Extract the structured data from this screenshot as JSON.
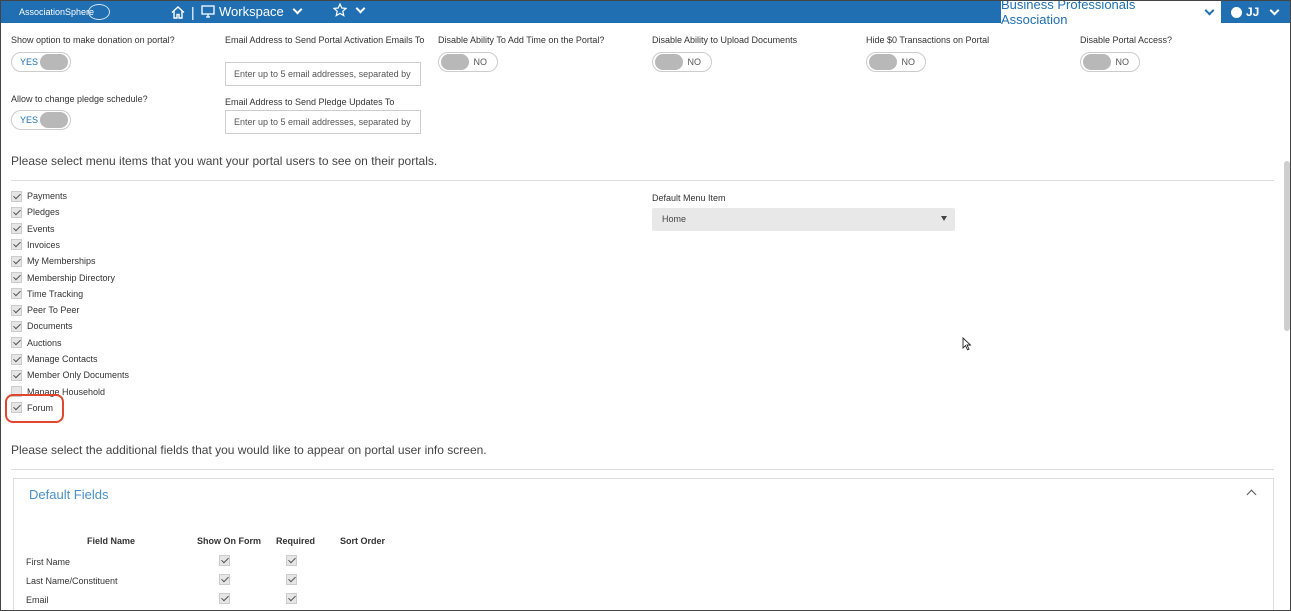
{
  "topbar": {
    "logo_text": "AssociationSphere",
    "workspace_label": "Workspace",
    "org_name": "Business Professionals Association",
    "user_initials": "JJ",
    "separator": "|"
  },
  "settings": {
    "donation": {
      "label": "Show option to make donation on portal?",
      "value": "YES"
    },
    "activation_email": {
      "label": "Email Address to Send Portal Activation Emails To",
      "placeholder": "Enter up to 5 email addresses, separated by"
    },
    "disable_add_time": {
      "label": "Disable Ability To Add Time on the Portal?",
      "value": "NO"
    },
    "disable_upload": {
      "label": "Disable Ability to Upload Documents",
      "value": "NO"
    },
    "hide_zero": {
      "label": "Hide $0 Transactions on Portal",
      "value": "NO"
    },
    "disable_portal": {
      "label": "Disable Portal Access?",
      "value": "NO"
    },
    "pledge_schedule": {
      "label": "Allow to change pledge schedule?",
      "value": "YES"
    },
    "pledge_email": {
      "label": "Email Address to Send Pledge Updates To",
      "placeholder": "Enter up to 5 email addresses, separated by"
    }
  },
  "menu_section_title": "Please select menu items that you want your portal users to see on their portals.",
  "menu_items": [
    {
      "label": "Payments",
      "checked": true
    },
    {
      "label": "Pledges",
      "checked": true
    },
    {
      "label": "Events",
      "checked": true
    },
    {
      "label": "Invoices",
      "checked": true
    },
    {
      "label": "My Memberships",
      "checked": true
    },
    {
      "label": "Membership Directory",
      "checked": true
    },
    {
      "label": "Time Tracking",
      "checked": true
    },
    {
      "label": "Peer To Peer",
      "checked": true
    },
    {
      "label": "Documents",
      "checked": true
    },
    {
      "label": "Auctions",
      "checked": true
    },
    {
      "label": "Manage Contacts",
      "checked": true
    },
    {
      "label": "Member Only Documents",
      "checked": true
    },
    {
      "label": "Manage Household",
      "checked": false
    },
    {
      "label": "Forum",
      "checked": true
    }
  ],
  "default_menu": {
    "label": "Default Menu Item",
    "value": "Home"
  },
  "fields_section_title": "Please select the additional fields that you would like to appear on portal user info screen.",
  "default_fields": {
    "title": "Default Fields",
    "headers": {
      "field_name": "Field Name",
      "show_on_form": "Show On Form",
      "required": "Required",
      "sort_order": "Sort Order"
    },
    "rows": [
      {
        "name": "First Name",
        "show": true,
        "required": true
      },
      {
        "name": "Last Name/Constituent",
        "show": true,
        "required": true
      },
      {
        "name": "Email",
        "show": true,
        "required": true
      }
    ]
  },
  "colors": {
    "brand": "#1f6fb2",
    "highlight": "#e0472e",
    "panel_title": "#4a90c8"
  }
}
